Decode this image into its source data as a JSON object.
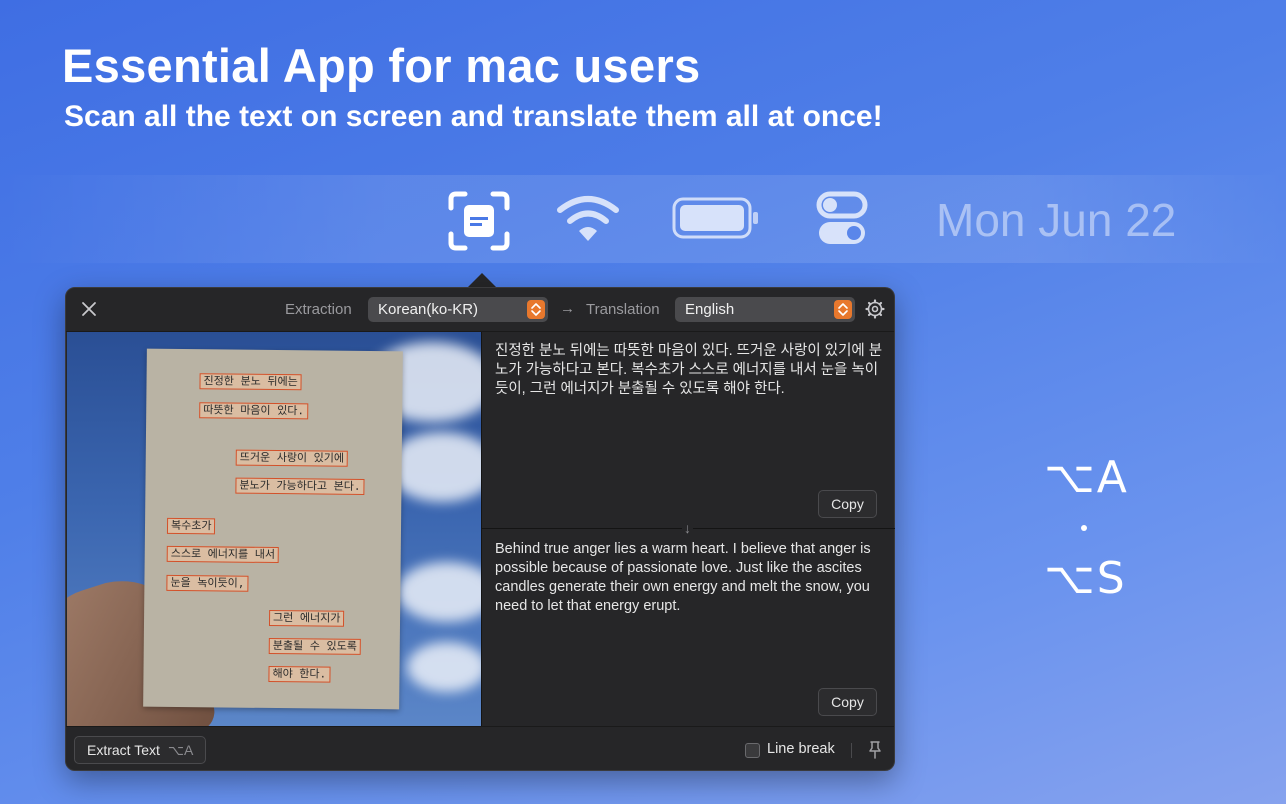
{
  "hero": {
    "headline": "Essential App for mac users",
    "subline": "Scan all the text on screen and translate them all at once!"
  },
  "menubar": {
    "icons": [
      "scan-text-icon",
      "wifi-icon",
      "battery-icon",
      "control-center-icon"
    ],
    "date": "Mon Jun 22"
  },
  "shortcuts": {
    "extract": "⌥A",
    "translate": "⌥S"
  },
  "panel": {
    "extraction_label": "Extraction",
    "extraction_value": "Korean(ko-KR)",
    "translation_label": "Translation",
    "translation_value": "English",
    "ocr_lines": [
      "진정한 분노 뒤에는",
      "따뜻한 마음이 있다.",
      "뜨거운 사랑이 있기에",
      "분노가 가능하다고 본다.",
      "복수초가",
      "스스로 에너지를 내서",
      "눈을 녹이듯이,",
      "그런 에너지가",
      "분출될 수 있도록",
      "해야 한다."
    ],
    "source_text": "진정한 분노 뒤에는 따뜻한 마음이 있다. 뜨거운 사랑이 있기에 분노가 가능하다고 본다. 복수초가 스스로 에너지를 내서 눈을 녹이듯이, 그런 에너지가 분출될 수 있도록 해야 한다.",
    "translated_text": "Behind true anger lies a warm heart. I believe that anger is possible because of passionate love. Just like the ascites candles generate their own energy and melt the snow, you need to let that energy erupt.",
    "copy_label": "Copy",
    "extract_button": "Extract Text",
    "extract_shortcut": "⌥A",
    "line_break_label": "Line break",
    "colors": {
      "accent": "#e8782d",
      "panel_bg": "#262628",
      "background_top": "#3f6ee3",
      "background_bottom": "#86a2ee"
    }
  }
}
